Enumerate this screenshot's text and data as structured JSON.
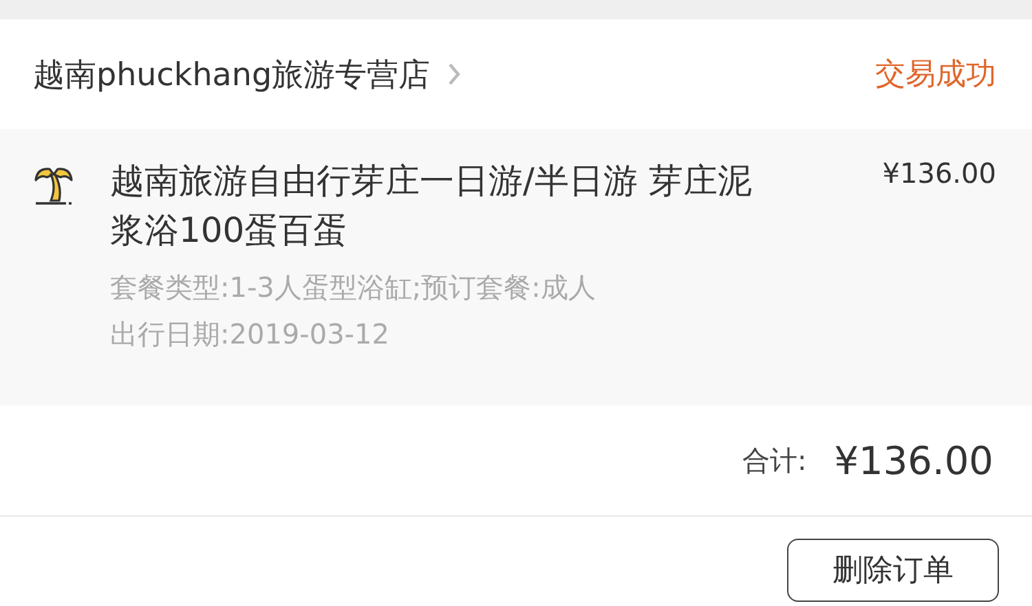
{
  "shop": {
    "name": "越南phuckhang旅游专营店",
    "status": "交易成功"
  },
  "item": {
    "title": "越南旅游自由行芽庄一日游/半日游 芽庄泥浆浴100蛋百蛋",
    "price": "¥136.00",
    "details": [
      "套餐类型:1-3人蛋型浴缸;预订套餐:成人",
      "出行日期:2019-03-12"
    ]
  },
  "total": {
    "label": "合计:",
    "amount": "¥136.00"
  },
  "actions": [
    "删除订单"
  ]
}
